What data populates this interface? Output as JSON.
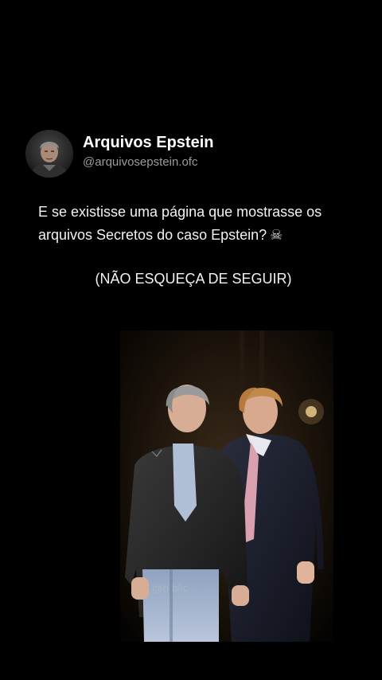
{
  "post": {
    "display_name": "Arquivos Epstein",
    "handle": "@arquivosepstein.ofc",
    "body_text": "E se existisse uma página que mostrasse os arquivos Secretos do caso Epstein?",
    "body_emoji": "☠",
    "cta_text": "(NÃO ESQUEÇA DE SEGUIR)",
    "photo_watermark": "@b      blic"
  },
  "colors": {
    "background": "#000000",
    "text": "#ffffff",
    "handle": "#9a9a9a"
  }
}
